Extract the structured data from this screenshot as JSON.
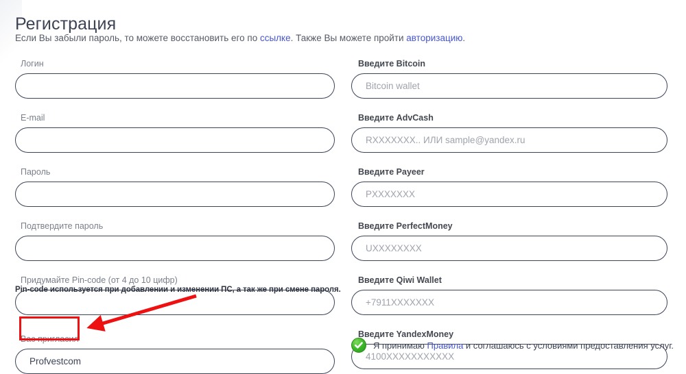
{
  "page": {
    "title": "Регистрация",
    "subtitle": {
      "part1": "Если Вы забыли пароль, то можете восстановить его по ",
      "link1": "ссылке",
      "part2": ". Также Вы можете пройти ",
      "link2": "авторизацию",
      "part3": "."
    },
    "link_color": "#4556cf",
    "input_border_color": "#3a4358",
    "annotation_color": "#ee1111"
  },
  "left_column": {
    "fields": [
      {
        "label": "Логин",
        "value": "",
        "placeholder": ""
      },
      {
        "label": "E-mail",
        "value": "",
        "placeholder": ""
      },
      {
        "label": "Пароль",
        "value": "",
        "placeholder": ""
      },
      {
        "label": "Подтвердите пароль",
        "value": "",
        "placeholder": ""
      },
      {
        "label": "Придумайте Pin-code (от 4 до 10 цифр)",
        "value": "",
        "placeholder": ""
      },
      {
        "label": "Вас пригласил",
        "value": "Profvestcom",
        "placeholder": ""
      }
    ],
    "hint": "Pin-code используется при добавлении и изменении ПС, а так же при смене пароля."
  },
  "right_column": {
    "fields": [
      {
        "label": "Введите Bitcoin",
        "value": "",
        "placeholder": "Bitcoin wallet"
      },
      {
        "label": "Введите AdvCash",
        "value": "",
        "placeholder": "RXXXXXXX.. ИЛИ sample@yandex.ru"
      },
      {
        "label": "Введите Payeer",
        "value": "",
        "placeholder": "PXXXXXXX"
      },
      {
        "label": "Введите PerfectMoney",
        "value": "",
        "placeholder": "UXXXXXXXX"
      },
      {
        "label": "Введите Qiwi Wallet",
        "value": "",
        "placeholder": "+7911XXXXXXX"
      },
      {
        "label": "Введите YandexMoney",
        "value": "",
        "placeholder": "4100XXXXXXXXXXX"
      }
    ]
  },
  "agreement": {
    "icon": "green-check-circle-icon",
    "part1": "Я принимаю ",
    "link": "Правила",
    "part2": " и соглашаюсь с условиями предоставления услуг."
  }
}
